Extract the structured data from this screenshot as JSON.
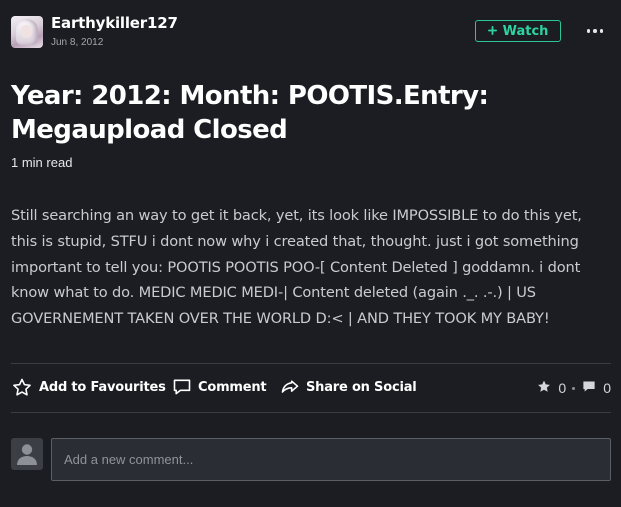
{
  "author": {
    "name": "Earthykiller127",
    "date": "Jun 8, 2012",
    "avatar_icon": "user-avatar-image"
  },
  "header": {
    "watch_label": "Watch",
    "watch_icon": "plus-icon",
    "more_icon": "more-horizontal-icon",
    "accent_color": "#2fd39f"
  },
  "post": {
    "title": "Year: 2012: Month: POOTIS.Entry: Megaupload Closed",
    "read_time": "1 min read",
    "body": "Still searching an way to get it back, yet, its look like IMPOSSIBLE to do this yet, this is stupid, STFU i dont now why i created that, thought. just i got something important to tell you: POOTIS POOTIS POO-[ Content Deleted ] goddamn. i dont know what to do. MEDIC MEDIC MEDI-| Content deleted (again ._. .-.) | US GOVERNEMENT TAKEN OVER THE WORLD D:< | AND THEY TOOK MY BABY!"
  },
  "actions": {
    "favourite_label": "Add to Favourites",
    "comment_label": "Comment",
    "share_label": "Share on Social",
    "favourites_count": "0",
    "comments_count": "0"
  },
  "comment_box": {
    "placeholder": "Add a new comment..."
  }
}
